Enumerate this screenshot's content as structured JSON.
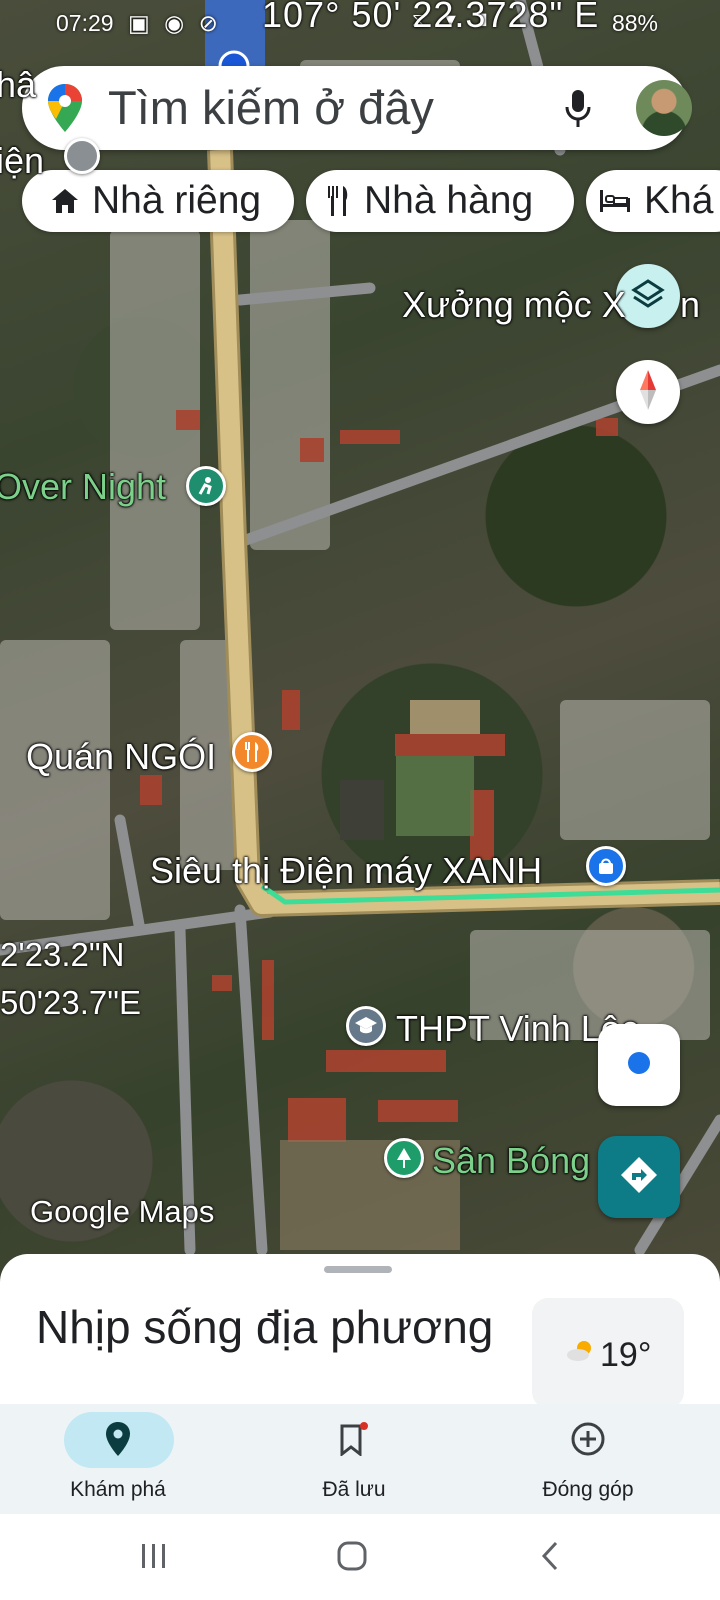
{
  "status_bar": {
    "time": "07:29",
    "battery": "88%",
    "icons": [
      "image-icon",
      "location-icon",
      "alert-icon",
      "wifi-icon",
      "signal-icon",
      "battery-icon"
    ]
  },
  "coordinates": {
    "top": "107° 50' 22.3728\" E",
    "left_line1": "2'23.2\"N",
    "left_line2": "50'23.7\"E"
  },
  "search": {
    "placeholder": "Tìm kiếm ở đây",
    "icon": "google-maps-pin-icon",
    "mic_icon": "mic-icon"
  },
  "chips": [
    {
      "label": "Nhà riêng",
      "icon": "home-icon"
    },
    {
      "label": "Nhà hàng",
      "icon": "restaurant-icon"
    },
    {
      "label": "Khá",
      "icon": "hotel-icon"
    }
  ],
  "map_labels": {
    "top_left_1": "hâ",
    "top_left_2": "iện",
    "xuong": "Xưởng mộc X",
    "xuong_tail": "n",
    "over_night": "Over Night",
    "quan_ngoi": "Quán NGÓI",
    "sieu_thi": "Siêu thị Điện máy XANH",
    "thpt": "THPT Vinh Lộc",
    "san_bong": "Sân Bóng"
  },
  "map_branding": "Google Maps",
  "sheet": {
    "title": "Nhịp sống địa phương",
    "temperature": "19°",
    "weather_icon": "partly-cloudy-icon"
  },
  "nav": [
    {
      "label": "Khám phá",
      "icon": "explore-pin-icon",
      "active": true
    },
    {
      "label": "Đã lưu",
      "icon": "bookmark-icon",
      "active": false
    },
    {
      "label": "Đóng góp",
      "icon": "add-circle-icon",
      "active": false
    }
  ],
  "colors": {
    "route": "#3ddc97",
    "road_main": "#d8c187",
    "accent_teal": "#0e7c86",
    "active_nav": "#c2e8f4"
  }
}
